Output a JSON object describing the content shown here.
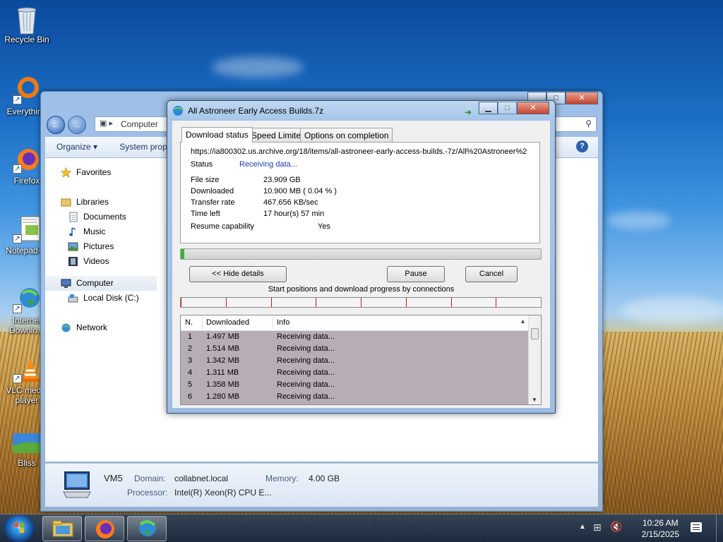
{
  "desktop": {
    "icons": [
      {
        "label": "Recycle Bin"
      },
      {
        "label": "Everything"
      },
      {
        "label": "Firefox"
      },
      {
        "label": "Notepad++"
      },
      {
        "label": "Internet Downlo..."
      },
      {
        "label": "VLC media player"
      },
      {
        "label": "Bliss"
      }
    ]
  },
  "explorer": {
    "address": "Computer",
    "toolbar": {
      "organize": "Organize ▾",
      "system_props": "System prop"
    },
    "nav": {
      "favorites": "Favorites",
      "libraries": "Libraries",
      "documents": "Documents",
      "music": "Music",
      "pictures": "Pictures",
      "videos": "Videos",
      "computer": "Computer",
      "local_disk": "Local Disk (C:)",
      "network": "Network"
    },
    "details": {
      "name": "VM5",
      "domain_label": "Domain:",
      "domain": "collabnet.local",
      "memory_label": "Memory:",
      "memory": "4.00 GB",
      "processor_label": "Processor:",
      "processor": "Intel(R) Xeon(R) CPU E..."
    }
  },
  "download": {
    "title": "All Astroneer Early Access Builds.7z",
    "tabs": [
      "Download status",
      "Speed Limiter",
      "Options on completion"
    ],
    "url": "https://ia800302.us.archive.org/18/items/all-astroneer-early-access-builds.-7z/All%20Astroneer%2",
    "status_label": "Status",
    "status": "Receiving data...",
    "file_size_label": "File size",
    "file_size": "23.909  GB",
    "downloaded_label": "Downloaded",
    "downloaded": "10.900  MB  ( 0.04 % )",
    "transfer_rate_label": "Transfer rate",
    "transfer_rate": "467.656  KB/sec",
    "time_left_label": "Time left",
    "time_left": "17 hour(s) 57 min",
    "resume_label": "Resume capability",
    "resume": "Yes",
    "progress_fraction": 0.0004,
    "buttons": {
      "hide_details": "<< Hide details",
      "pause": "Pause",
      "cancel": "Cancel"
    },
    "connections_caption": "Start positions and download progress by connections",
    "columns": [
      "N.",
      "Downloaded",
      "Info"
    ],
    "connections": [
      {
        "n": "1",
        "downloaded": "1.497  MB",
        "info": "Receiving data..."
      },
      {
        "n": "2",
        "downloaded": "1.514  MB",
        "info": "Receiving data..."
      },
      {
        "n": "3",
        "downloaded": "1.342  MB",
        "info": "Receiving data..."
      },
      {
        "n": "4",
        "downloaded": "1.311  MB",
        "info": "Receiving data..."
      },
      {
        "n": "5",
        "downloaded": "1.358  MB",
        "info": "Receiving data..."
      },
      {
        "n": "6",
        "downloaded": "1.280  MB",
        "info": "Receiving data..."
      }
    ]
  },
  "taskbar": {
    "time": "10:26 AM",
    "date": "2/15/2025"
  }
}
